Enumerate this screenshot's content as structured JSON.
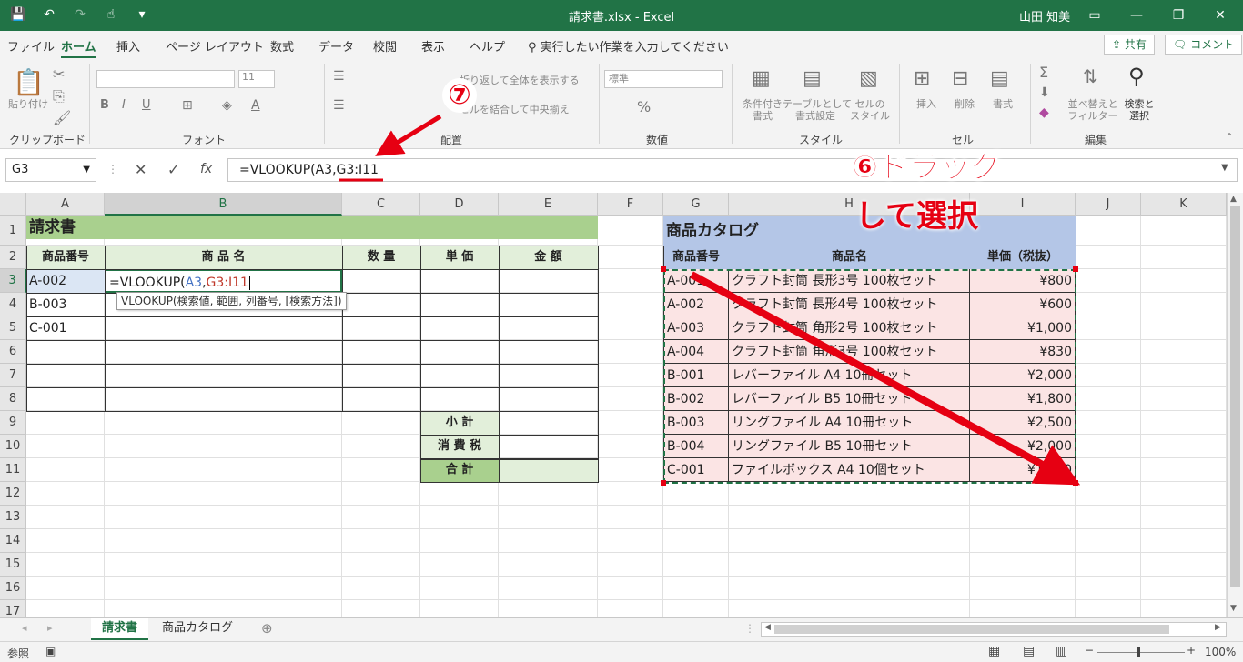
{
  "title_bar": {
    "doc_title": "請求書.xlsx  -  Excel",
    "user": "山田 知美"
  },
  "tabs": [
    "ファイル",
    "ホーム",
    "挿入",
    "ページ レイアウト",
    "数式",
    "データ",
    "校閲",
    "表示",
    "ヘルプ"
  ],
  "tell_me": "実行したい作業を入力してください",
  "share_label": "共有",
  "comment_label": "コメント",
  "ribbon": {
    "clipboard": {
      "paste": "貼り付け",
      "label": "クリップボード"
    },
    "font": {
      "name": "",
      "size": "11",
      "label": "フォント"
    },
    "alignment": {
      "wrap": "折り返して全体を表示する",
      "merge": "セルを結合して中央揃え",
      "label": "配置"
    },
    "number": {
      "format": "標準",
      "label": "数値"
    },
    "styles": {
      "conditional": "条件付き\n書式",
      "table": "テーブルとして\n書式設定",
      "cell": "セルの\nスタイル",
      "label": "スタイル"
    },
    "cells": {
      "insert": "挿入",
      "delete": "削除",
      "format": "書式",
      "label": "セル"
    },
    "editing": {
      "sort": "並べ替えと\nフィルター",
      "find": "検索と\n選択",
      "label": "編集"
    }
  },
  "formula_bar": {
    "name_box": "G3",
    "formula_prefix": "=VLOOKUP(A3,",
    "formula_range": "G3:I11"
  },
  "columns": [
    "A",
    "B",
    "C",
    "D",
    "E",
    "F",
    "G",
    "H",
    "I",
    "J",
    "K"
  ],
  "rows": [
    "1",
    "2",
    "3",
    "4",
    "5",
    "6",
    "7",
    "8",
    "9",
    "10",
    "11",
    "12",
    "13",
    "14",
    "15",
    "16",
    "17"
  ],
  "invoice": {
    "title": "請求書",
    "headers": [
      "商品番号",
      "商 品 名",
      "数 量",
      "単 価",
      "金 額"
    ],
    "item_codes": [
      "A-002",
      "B-003",
      "C-001"
    ],
    "edit_formula_a": "=VLOOKUP(",
    "edit_formula_b": "A3",
    "edit_formula_c": ",",
    "edit_formula_d": "G3:I11",
    "tooltip": "VLOOKUP(検索値, 範囲, 列番号, [検索方法])",
    "subtotal": "小 計",
    "tax": "消 費 税",
    "total": "合 計"
  },
  "catalog": {
    "title": "商品カタログ",
    "headers": [
      "商品番号",
      "商品名",
      "単価（税抜）"
    ],
    "rows": [
      {
        "code": "A-001",
        "name": "クラフト封筒 長形3号 100枚セット",
        "price": "¥800"
      },
      {
        "code": "A-002",
        "name": "クラフト封筒 長形4号 100枚セット",
        "price": "¥600"
      },
      {
        "code": "A-003",
        "name": "クラフト封筒 角形2号 100枚セット",
        "price": "¥1,000"
      },
      {
        "code": "A-004",
        "name": "クラフト封筒 角形3号 100枚セット",
        "price": "¥830"
      },
      {
        "code": "B-001",
        "name": "レバーファイル A4 10冊セット",
        "price": "¥2,000"
      },
      {
        "code": "B-002",
        "name": "レバーファイル B5 10冊セット",
        "price": "¥1,800"
      },
      {
        "code": "B-003",
        "name": "リングファイル A4 10冊セット",
        "price": "¥2,500"
      },
      {
        "code": "B-004",
        "name": "リングファイル B5 10冊セット",
        "price": "¥2,000"
      },
      {
        "code": "C-001",
        "name": "ファイルボックス A4 10個セット",
        "price": "¥1,200"
      }
    ]
  },
  "sheets": [
    "請求書",
    "商品カタログ"
  ],
  "status": {
    "mode": "参照",
    "zoom": "100%"
  },
  "annotations": {
    "step7": "⑦",
    "step6_line1": "⑥ドラッグ",
    "step6_line2": "して選択"
  },
  "colors": {
    "excel_green": "#217346",
    "annotation_red": "#e60012",
    "invoice_header": "#e2efda",
    "catalog_header": "#b4c6e7",
    "catalog_rows": "#fbe4e4"
  }
}
